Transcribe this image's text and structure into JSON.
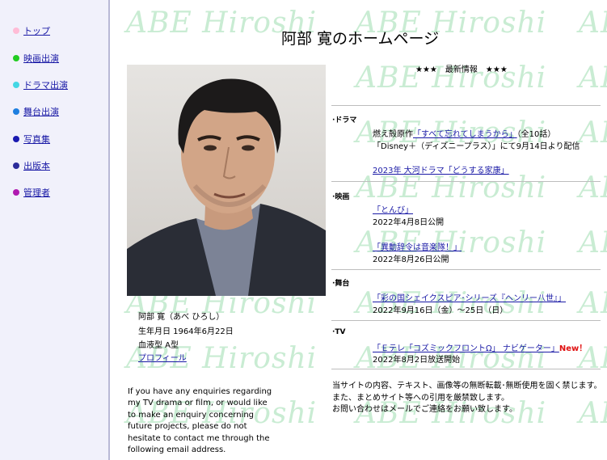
{
  "sidebar": {
    "items": [
      {
        "label": "トップ",
        "color": "#ffbcd6"
      },
      {
        "label": "映画出演",
        "color": "#22cc22"
      },
      {
        "label": "ドラマ出演",
        "color": "#44d7e4"
      },
      {
        "label": "舞台出演",
        "color": "#1e7fe0"
      },
      {
        "label": "写真集",
        "color": "#1a1ab0"
      },
      {
        "label": "出版本",
        "color": "#2c2c9a"
      },
      {
        "label": "管理者",
        "color": "#b01ab0"
      }
    ]
  },
  "watermark": {
    "text": "ABE Hiroshi"
  },
  "page_title": "阿部 寛のホームページ",
  "profile": {
    "name": "阿部 寛（あべ ひろし）",
    "birthday": "生年月日 1964年6月22日",
    "blood_type": "血液型 A型",
    "profile_link": "プロフィール"
  },
  "enquiry_text": "If you have any enquiries regarding my TV drama or film, or would like to make an enquiry concerning future projects, please do not hesitate to contact me through the following email address.",
  "news": {
    "header": "★★★　最新情報　★★★",
    "drama": {
      "label": "·ドラマ",
      "line1_prefix": "燃え殻原作",
      "line1_link": "「すべて忘れてしまうから」",
      "line1_suffix": "（全10話）",
      "line2": "「Disney＋（ディズニープラス）」にて9月14日より配信",
      "line3_link": "2023年 大河ドラマ「どうする家康」"
    },
    "movie": {
      "label": "·映画",
      "item1_link": "「とんび」",
      "item1_date": "2022年4月8日公開",
      "item2_link": "「異動辞令は音楽隊！」",
      "item2_date": "2022年8月26日公開"
    },
    "stage": {
      "label": "·舞台",
      "item1_link": "「彩の国シェイクスピア･シリーズ『ヘンリー八世』」",
      "item1_date": "2022年9月16日（金）～25日（日）"
    },
    "tv": {
      "label": "·TV",
      "item1_link": "「Ｅテレ「コズミックフロントΩ」 ナビゲーター」",
      "new_badge": "New！",
      "item1_date": "2022年8月2日放送開始"
    }
  },
  "notice": {
    "line1": "当サイトの内容、テキスト、画像等の無断転載･無断使用を固く禁じます。",
    "line2": "また、まとめサイト等への引用を厳禁致します。",
    "line3": "お問い合わせはメールでご連絡をお願い致します。"
  }
}
